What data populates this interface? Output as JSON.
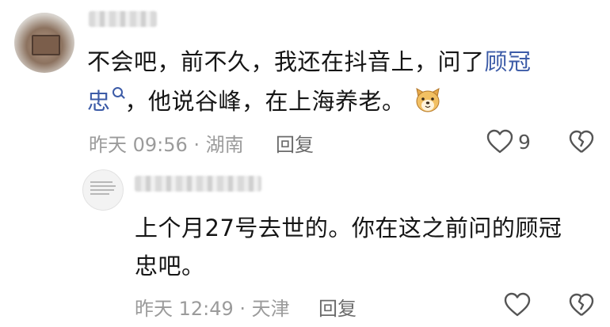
{
  "comments": [
    {
      "line1_text": "不会吧，前不久，我还在抖音上，问了",
      "line1_link": "顾冠",
      "line2_link": "忠",
      "line2_text": "，他说谷峰，在上海养老。",
      "emoji": "dog-face-emoji",
      "meta": "昨天 09:56 · 湖南",
      "reply_label": "回复",
      "like_count": "9"
    },
    {
      "line1_text": "上个月27号去世的。你在这之前问的顾冠",
      "line2_text": "忠吧。",
      "meta": "昨天 12:49 · 天津",
      "reply_label": "回复"
    }
  ],
  "colors": {
    "link": "#3c5ba7",
    "meta": "#9b9b9b",
    "text": "#151515"
  }
}
